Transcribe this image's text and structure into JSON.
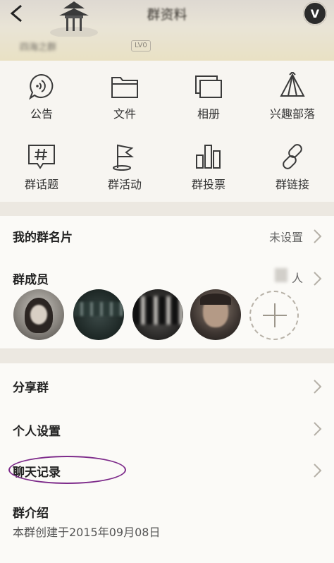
{
  "header": {
    "title": "群资料",
    "group_name": "四海之群",
    "level_badge": "LV0",
    "vip_badge": "V"
  },
  "grid": [
    {
      "label": "公告",
      "icon": "announcement-icon"
    },
    {
      "label": "文件",
      "icon": "folder-icon"
    },
    {
      "label": "相册",
      "icon": "album-icon"
    },
    {
      "label": "兴趣部落",
      "icon": "tent-icon"
    },
    {
      "label": "群话题",
      "icon": "hashtag-icon"
    },
    {
      "label": "群活动",
      "icon": "flag-icon"
    },
    {
      "label": "群投票",
      "icon": "bar-chart-icon"
    },
    {
      "label": "群链接",
      "icon": "link-icon"
    }
  ],
  "my_card": {
    "label": "我的群名片",
    "value": "未设置"
  },
  "members": {
    "label": "群成员",
    "count_suffix": "人"
  },
  "share": {
    "label": "分享群"
  },
  "personal": {
    "label": "个人设置"
  },
  "history": {
    "label": "聊天记录"
  },
  "intro": {
    "label": "群介绍",
    "text": "本群创建于2015年09月08日"
  },
  "colors": {
    "accent_purple": "#7d2a8a",
    "background": "#f3f0ea"
  }
}
